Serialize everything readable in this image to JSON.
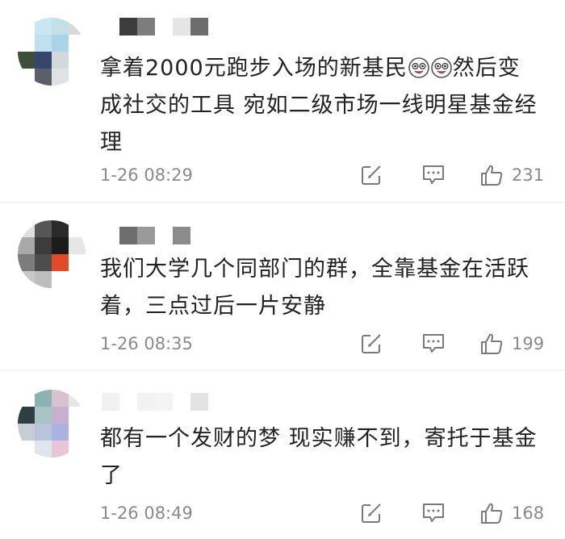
{
  "comments": [
    {
      "text_a": "拿着2000元跑步入场的新基民",
      "text_b": "然后变成社交的工具 宛如二级市场一线明星基金经理",
      "emoji": [
        "laughing-crying-emoji",
        "laughing-crying-emoji"
      ],
      "time": "1-26 08:29",
      "likes": "231",
      "avatar_colors": [
        "#ffffff",
        "#c9e6f2",
        "#c3dfe9",
        "#d9d9d9",
        "#ffffff",
        "#bfe0ee",
        "#a9d3e6",
        "#ffffff",
        "#3f4e3a",
        "#36466c",
        "#d5d8db",
        "#ffffff",
        "#ffffff",
        "#5a5f6b",
        "#dfe1e4",
        "#ffffff"
      ],
      "name_colors": [
        "#ffffff",
        "#3c3c3c",
        "#7d7d7d",
        "#ffffff",
        "#e5e5e5",
        "#6d6d6d"
      ]
    },
    {
      "text": "我们大学几个同部门的群，全靠基金在活跃着，三点过后一片安静",
      "time": "1-26 08:35",
      "likes": "199",
      "avatar_colors": [
        "#e0e0e0",
        "#565656",
        "#2a2a2a",
        "#ffffff",
        "#a9a9a9",
        "#3c3c3c",
        "#1c1c1c",
        "#e6e6e6",
        "#7c7c7c",
        "#4d4d4d",
        "#e34a2a",
        "#ffffff",
        "#c9c9c9",
        "#bdbdbd",
        "#ffffff",
        "#ffffff"
      ],
      "name_colors": [
        "#ffffff",
        "#6e6e6e",
        "#9a9a9a",
        "#ffffff",
        "#8c8c8c",
        "#ffffff"
      ]
    },
    {
      "text": "都有一个发财的梦 现实赚不到，寄托于基金了",
      "time": "1-26 08:49",
      "likes": "168",
      "avatar_colors": [
        "#ffffff",
        "#8bb3b3",
        "#d6c3cf",
        "#e7e7e7",
        "#2f3d44",
        "#a7c5c4",
        "#c8afcf",
        "#ffffff",
        "#c7cdd5",
        "#b7c4dc",
        "#aab3e0",
        "#ffffff",
        "#ffffff",
        "#dfe6ef",
        "#e9c6d7",
        "#ffffff"
      ],
      "name_colors": [
        "#f1f1f1",
        "#ffffff",
        "#f2f2f2",
        "#f4f4f4",
        "#ffffff",
        "#e3e3e3"
      ]
    }
  ],
  "icons": {
    "share": "share-edit-icon",
    "comment": "comment-bubble-icon",
    "like": "thumbs-up-icon"
  },
  "colors": {
    "text": "#222222",
    "meta": "#8a8a8a",
    "icon": "#7a7a7a",
    "divider": "#ececec"
  }
}
